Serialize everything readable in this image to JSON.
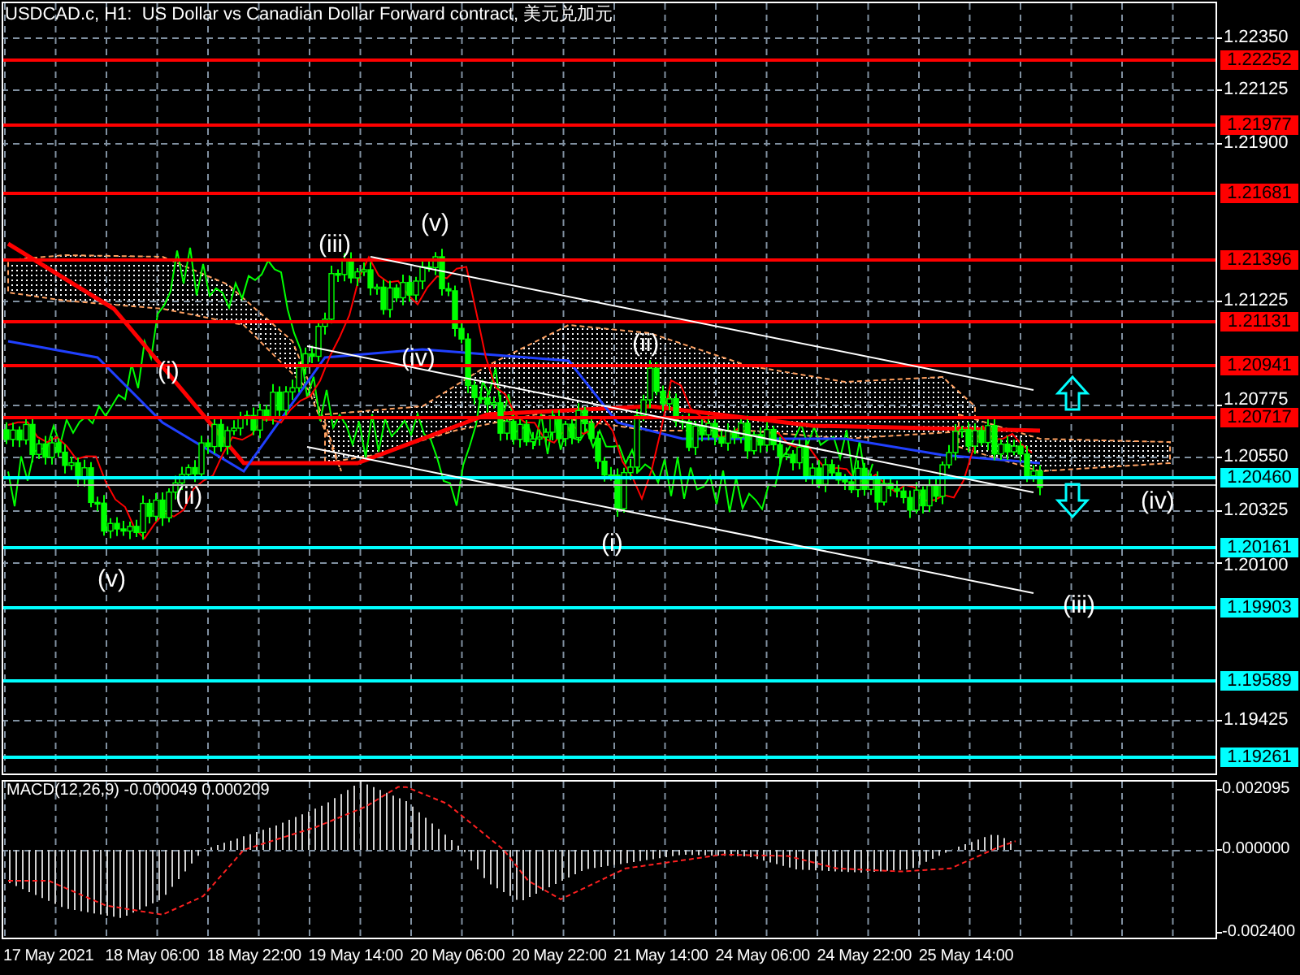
{
  "chart": {
    "title": "USDCAD.c, H1:  US Dollar vs Canadian Dollar Forward contract, 美元兑加元"
  },
  "price_axis": {
    "ticks": [
      "1.22350",
      "1.22125",
      "1.21900",
      "1.21225",
      "1.20775",
      "1.20550",
      "1.20325",
      "1.20100",
      "1.19425"
    ]
  },
  "levels": [
    {
      "label": "1.22252",
      "color": "#ff0000"
    },
    {
      "label": "1.21977",
      "color": "#ff0000"
    },
    {
      "label": "1.21681",
      "color": "#ff0000"
    },
    {
      "label": "1.21396",
      "color": "#ff0000"
    },
    {
      "label": "1.21131",
      "color": "#ff0000"
    },
    {
      "label": "1.20941",
      "color": "#ff0000"
    },
    {
      "label": "1.20717",
      "color": "#ff0000"
    },
    {
      "label": "1.20460",
      "color": "#00ffff"
    },
    {
      "label": "1.20161",
      "color": "#00ffff"
    },
    {
      "label": "1.19903",
      "color": "#00ffff"
    },
    {
      "label": "1.19589",
      "color": "#00ffff"
    },
    {
      "label": "1.19261",
      "color": "#00ffff"
    }
  ],
  "wave_labels": [
    "(v)",
    "(iii)",
    "(ii)",
    "(i)",
    "(iv)",
    "(ii)",
    "(iv)",
    "(i)",
    "(v)",
    "(iii)"
  ],
  "macd": {
    "label": "MACD(12,26,9) -0.000049 0.000209",
    "ticks": [
      "0.002095",
      "0.000000",
      "-0.002400"
    ]
  },
  "time_axis": {
    "ticks": [
      "17 May 2021",
      "18 May 06:00",
      "18 May 22:00",
      "19 May 14:00",
      "20 May 06:00",
      "20 May 22:00",
      "21 May 14:00",
      "24 May 06:00",
      "24 May 22:00",
      "25 May 14:00"
    ]
  }
}
